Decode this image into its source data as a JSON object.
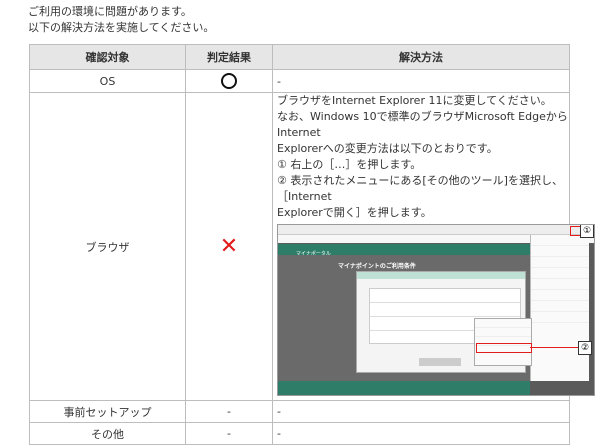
{
  "intro": {
    "line1": "ご利用の環境に問題があります。",
    "line2": "以下の解決方法を実施してください。"
  },
  "table": {
    "headers": [
      "確認対象",
      "判定結果",
      "解決方法"
    ],
    "rows": {
      "os": {
        "target": "OS",
        "result_icon": "circle-ok-icon",
        "method": "-"
      },
      "browser": {
        "target": "ブラウザ",
        "result_icon": "cross-ng-icon",
        "result_mark": "✕",
        "method_lines": [
          "ブラウザをInternet Explorer 11に変更してください。",
          "なお、Windows 10で標準のブラウザMicrosoft EdgeからInternet",
          "Explorerへの変更方法は以下のとおりです。",
          "① 右上の［…］を押します。",
          "② 表示されたメニューにある[その他のツール]を選択し、［Internet",
          "Explorerで開く］を押します。"
        ],
        "screenshot": {
          "site_header": "マイナポータル",
          "site_title": "マイナポイントのご利用条件",
          "marker1": "①",
          "marker2": "②"
        }
      },
      "setup": {
        "target": "事前セットアップ",
        "result": "-",
        "method": "-"
      },
      "other": {
        "target": "その他",
        "result": "-",
        "method": "-"
      }
    }
  },
  "colors": {
    "header_bg": "#e6e6e6",
    "border": "#bdbdbd",
    "ng_red": "#e21b1b",
    "site_green": "#2d7d68"
  }
}
